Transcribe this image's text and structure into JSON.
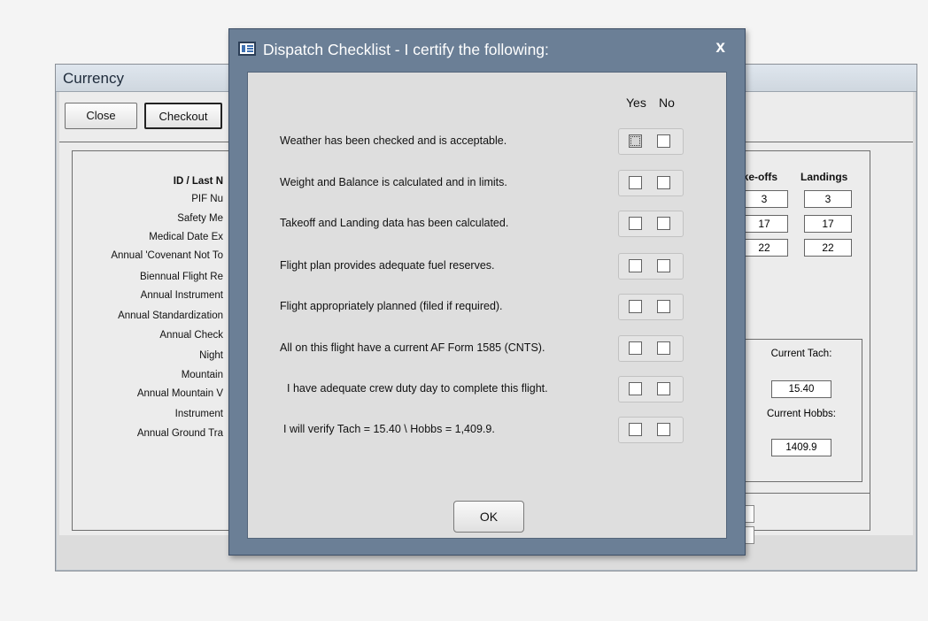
{
  "background_window": {
    "title": "Currency",
    "close_label": "Close",
    "checkout_label": "Checkout",
    "labels": [
      "ID / Last N",
      "PIF Nu",
      "Safety Me",
      "Medical Date Ex",
      "Annual 'Covenant Not To",
      "Biennual Flight Re",
      "Annual Instrument",
      "Annual Standardization",
      "Annual Check",
      "Night",
      "Mountain",
      "Annual Mountain V",
      "Instrument",
      "Annual Ground Tra"
    ],
    "table": {
      "headers": [
        "ake-offs",
        "Landings"
      ],
      "rows": [
        [
          "3",
          "3"
        ],
        [
          "17",
          "17"
        ],
        [
          "22",
          "22"
        ]
      ]
    },
    "current_tach_label": "Current Tach:",
    "current_tach_value": "15.40",
    "current_hobbs_label": "Current Hobbs:",
    "current_hobbs_value": "1409.9"
  },
  "dialog": {
    "title": "Dispatch Checklist - I certify the following:",
    "close_glyph": "x",
    "yes_header": "Yes",
    "no_header": "No",
    "items": [
      "Weather has been checked and is acceptable.",
      "Weight and Balance is calculated and in limits.",
      "Takeoff and Landing data has been calculated.",
      "Flight plan provides adequate fuel reserves.",
      "Flight appropriately planned (filed if required).",
      "All on this flight have a current AF Form 1585 (CNTS).",
      "I have adequate crew duty day to complete this flight.",
      "I will verify Tach = 15.40 \\ Hobbs = 1,409.9."
    ],
    "ok_label": "OK"
  },
  "colors": {
    "dialog_frame": "#6b7f96",
    "dialog_body": "#dedede"
  }
}
